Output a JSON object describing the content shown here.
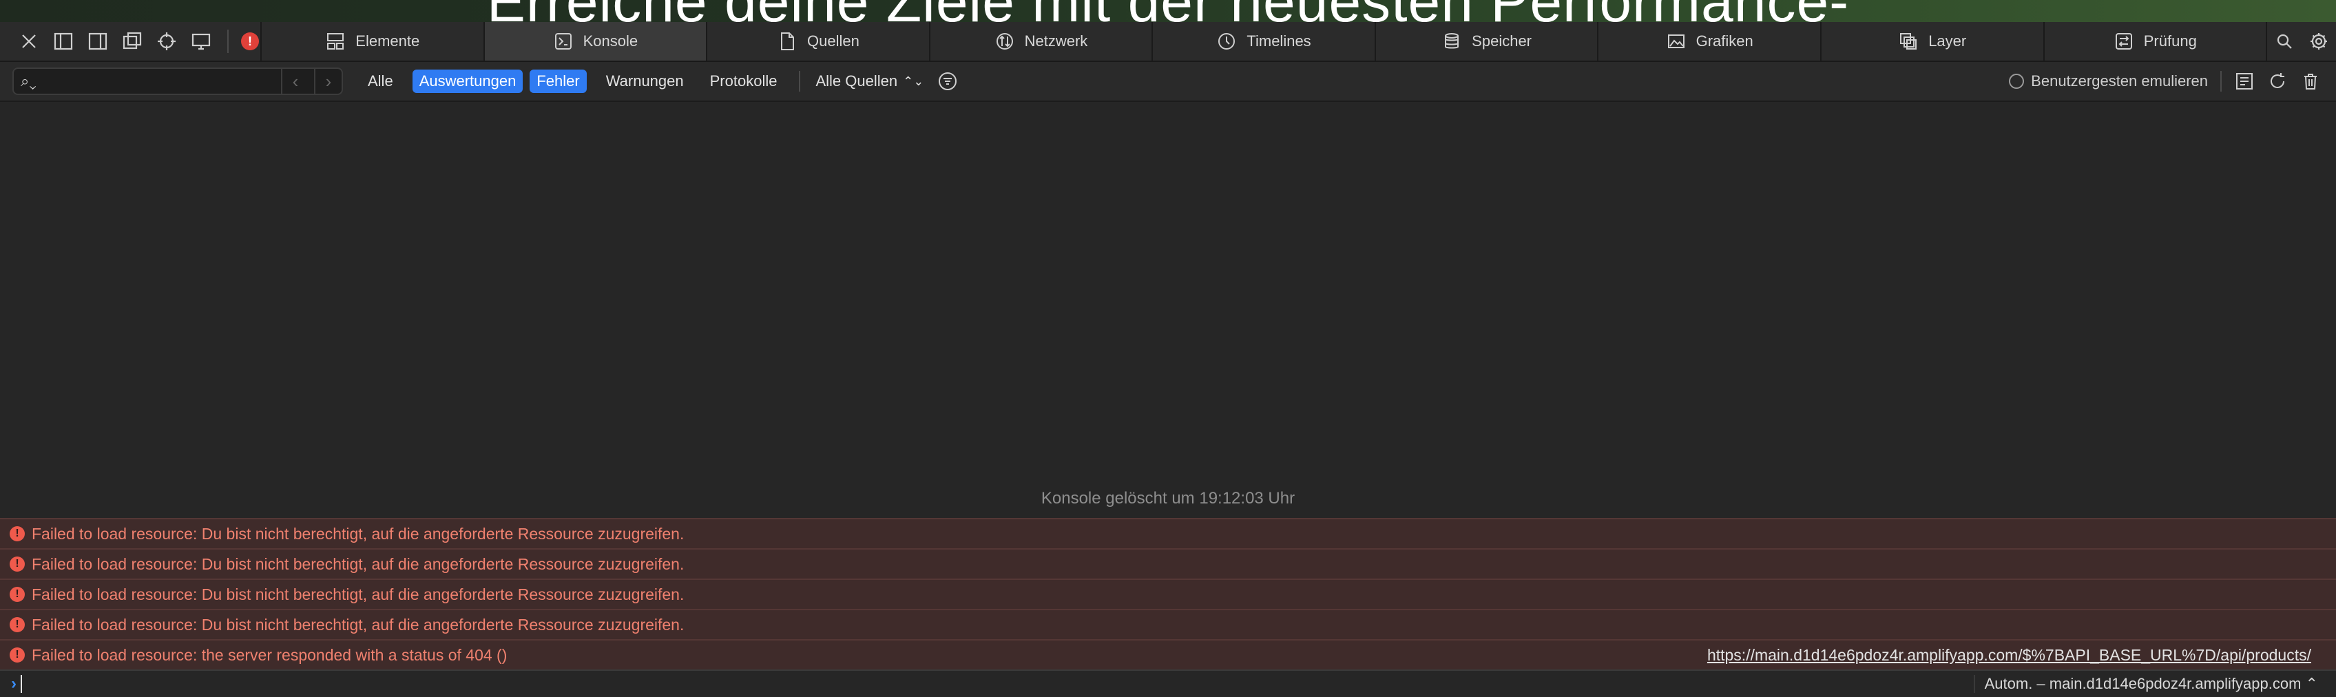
{
  "page": {
    "heading": "Erreiche deine Ziele mit der neuesten Performance-"
  },
  "tabs": [
    {
      "label": "Elemente",
      "icon": "elements-icon"
    },
    {
      "label": "Konsole",
      "icon": "console-icon"
    },
    {
      "label": "Quellen",
      "icon": "sources-icon"
    },
    {
      "label": "Netzwerk",
      "icon": "network-icon"
    },
    {
      "label": "Timelines",
      "icon": "timelines-icon"
    },
    {
      "label": "Speicher",
      "icon": "storage-icon"
    },
    {
      "label": "Grafiken",
      "icon": "graphics-icon"
    },
    {
      "label": "Layer",
      "icon": "layers-icon"
    },
    {
      "label": "Prüfung",
      "icon": "audit-icon"
    }
  ],
  "error_badge": "!",
  "filter": {
    "search_placeholder": "",
    "buttons": [
      "Alle",
      "Auswertungen",
      "Fehler",
      "Warnungen",
      "Protokolle"
    ],
    "sources": "Alle Quellen",
    "emulate_gesture": "Benutzergesten emulieren"
  },
  "console": {
    "cleared": "Konsole gelöscht um 19:12:03 Uhr",
    "messages": [
      {
        "text": "Failed to load resource: Du bist nicht berechtigt, auf die angeforderte Ressource zuzugreifen.",
        "source": ""
      },
      {
        "text": "Failed to load resource: Du bist nicht berechtigt, auf die angeforderte Ressource zuzugreifen.",
        "source": ""
      },
      {
        "text": "Failed to load resource: Du bist nicht berechtigt, auf die angeforderte Ressource zuzugreifen.",
        "source": ""
      },
      {
        "text": "Failed to load resource: Du bist nicht berechtigt, auf die angeforderte Ressource zuzugreifen.",
        "source": ""
      },
      {
        "text": "Failed to load resource: the server responded with a status of 404 ()",
        "source": "https://main.d1d14e6pdoz4r.amplifyapp.com/$%7BAPI_BASE_URL%7D/api/products/"
      }
    ],
    "context": "Autom. – main.d1d14e6pdoz4r.amplifyapp.com ⌃"
  },
  "colors": {
    "accent": "#2f7bf2",
    "error_text": "#f0816f",
    "error_bg": "#3f2b2a"
  }
}
